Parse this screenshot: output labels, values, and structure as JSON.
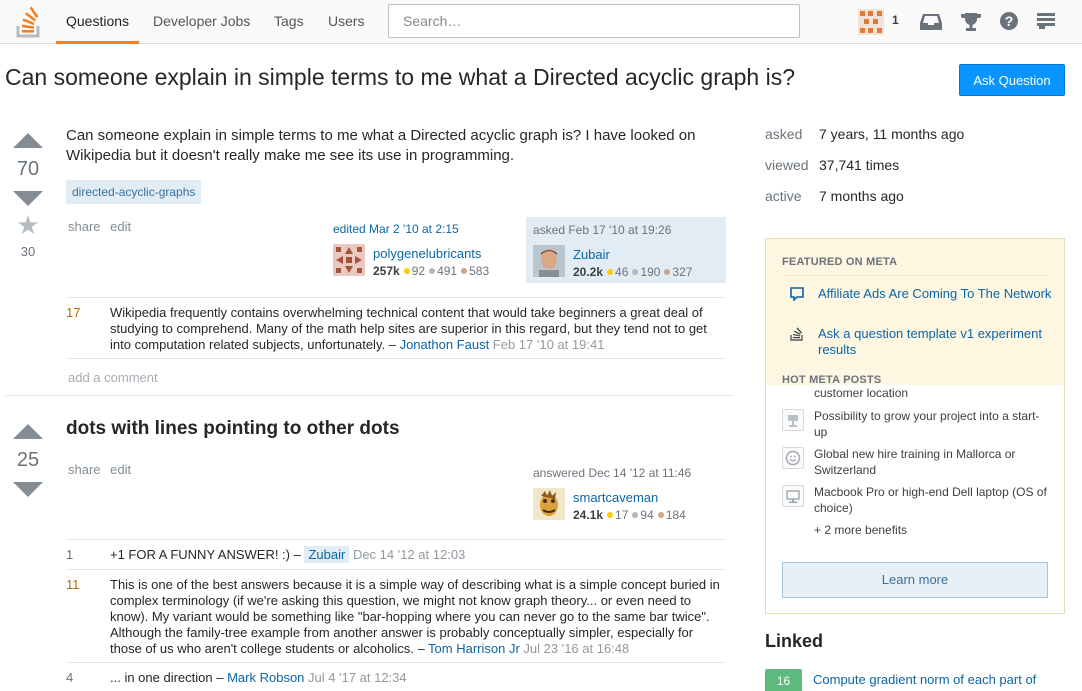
{
  "nav": {
    "questions": "Questions",
    "jobs": "Developer Jobs",
    "tags": "Tags",
    "users": "Users",
    "search_placeholder": "Search…",
    "inbox_count": "1"
  },
  "question": {
    "title": "Can someone explain in simple terms to me what a Directed acyclic graph is?",
    "ask_button": "Ask Question",
    "votes": "70",
    "favorites": "30",
    "body": "Can someone explain in simple terms to me what a Directed acyclic graph is? I have looked on Wikipedia but it doesn't really make me see its use in programming.",
    "tag": "directed-acyclic-graphs",
    "share": "share",
    "edit": "edit",
    "edited": {
      "time": "edited Mar 2 '10 at 2:15",
      "user": "polygenelubricants",
      "rep": "257k",
      "gold": "92",
      "silver": "491",
      "bronze": "583"
    },
    "asked": {
      "time": "asked Feb 17 '10 at 19:26",
      "user": "Zubair",
      "rep": "20.2k",
      "gold": "46",
      "silver": "190",
      "bronze": "327"
    },
    "comments": [
      {
        "score": "17",
        "text": "Wikipedia frequently contains overwhelming technical content that would take beginners a great deal of studying to comprehend. Many of the math help sites are superior in this regard, but they tend not to get into computation related subjects, unfortunately.",
        "sep": " – ",
        "user": "Jonathon Faust",
        "time": " Feb 17 '10 at 19:41"
      }
    ],
    "add_comment": "add a comment"
  },
  "answer": {
    "votes": "25",
    "title": "dots with lines pointing to other dots",
    "share": "share",
    "edit": "edit",
    "answered": {
      "time": "answered Dec 14 '12 at 11:46",
      "user": "smartcaveman",
      "rep": "24.1k",
      "gold": "17",
      "silver": "94",
      "bronze": "184"
    },
    "comments": [
      {
        "score": "1",
        "text": "+1 FOR A FUNNY ANSWER! :)",
        "sep": " – ",
        "user": "Zubair",
        "time": " Dec 14 '12 at 12:03"
      },
      {
        "score": "11",
        "text": "This is one of the best answers because it is a simple way of describing what is a simple concept buried in complex terminology (if we're asking this question, we might not know graph theory... or even need to know). My variant would be something like \"bar-hopping where you can never go to the same bar twice\". Although the family-tree example from another answer is probably conceptually simpler, especially for those of us who aren't college students or alcoholics.",
        "sep": " – ",
        "user": "Tom Harrison Jr",
        "time": " Jul 23 '16 at 16:48"
      },
      {
        "score": "4",
        "text": "... in one direction",
        "sep": " – ",
        "user": "Mark Robson",
        "time": " Jul 4 '17 at 12:34"
      }
    ]
  },
  "sidebar": {
    "stats": [
      {
        "label": "asked",
        "value": "7 years, 11 months ago"
      },
      {
        "label": "viewed",
        "value": "37,741 times"
      },
      {
        "label": "active",
        "value": "7 months ago"
      }
    ],
    "featured_heading": "FEATURED ON META",
    "featured": [
      "Affiliate Ads Are Coming To The Network",
      "Ask a question template v1 experiment results"
    ],
    "hot_heading": "HOT META POSTS",
    "benefits": [
      "customer location",
      "Possibility to grow your project into a start-up",
      "Global new hire training in Mallorca or Switzerland",
      "Macbook Pro or high-end Dell laptop (OS of choice)",
      "+ 2 more benefits"
    ],
    "learn_more": "Learn more",
    "linked_heading": "Linked",
    "linked": [
      {
        "score": "16",
        "title": "Compute gradient norm of each part of"
      }
    ]
  },
  "colors": {
    "accent": "#f48024",
    "link": "#0c65a5",
    "button": "#0995ff",
    "featured_bg": "#fdf7e2"
  }
}
